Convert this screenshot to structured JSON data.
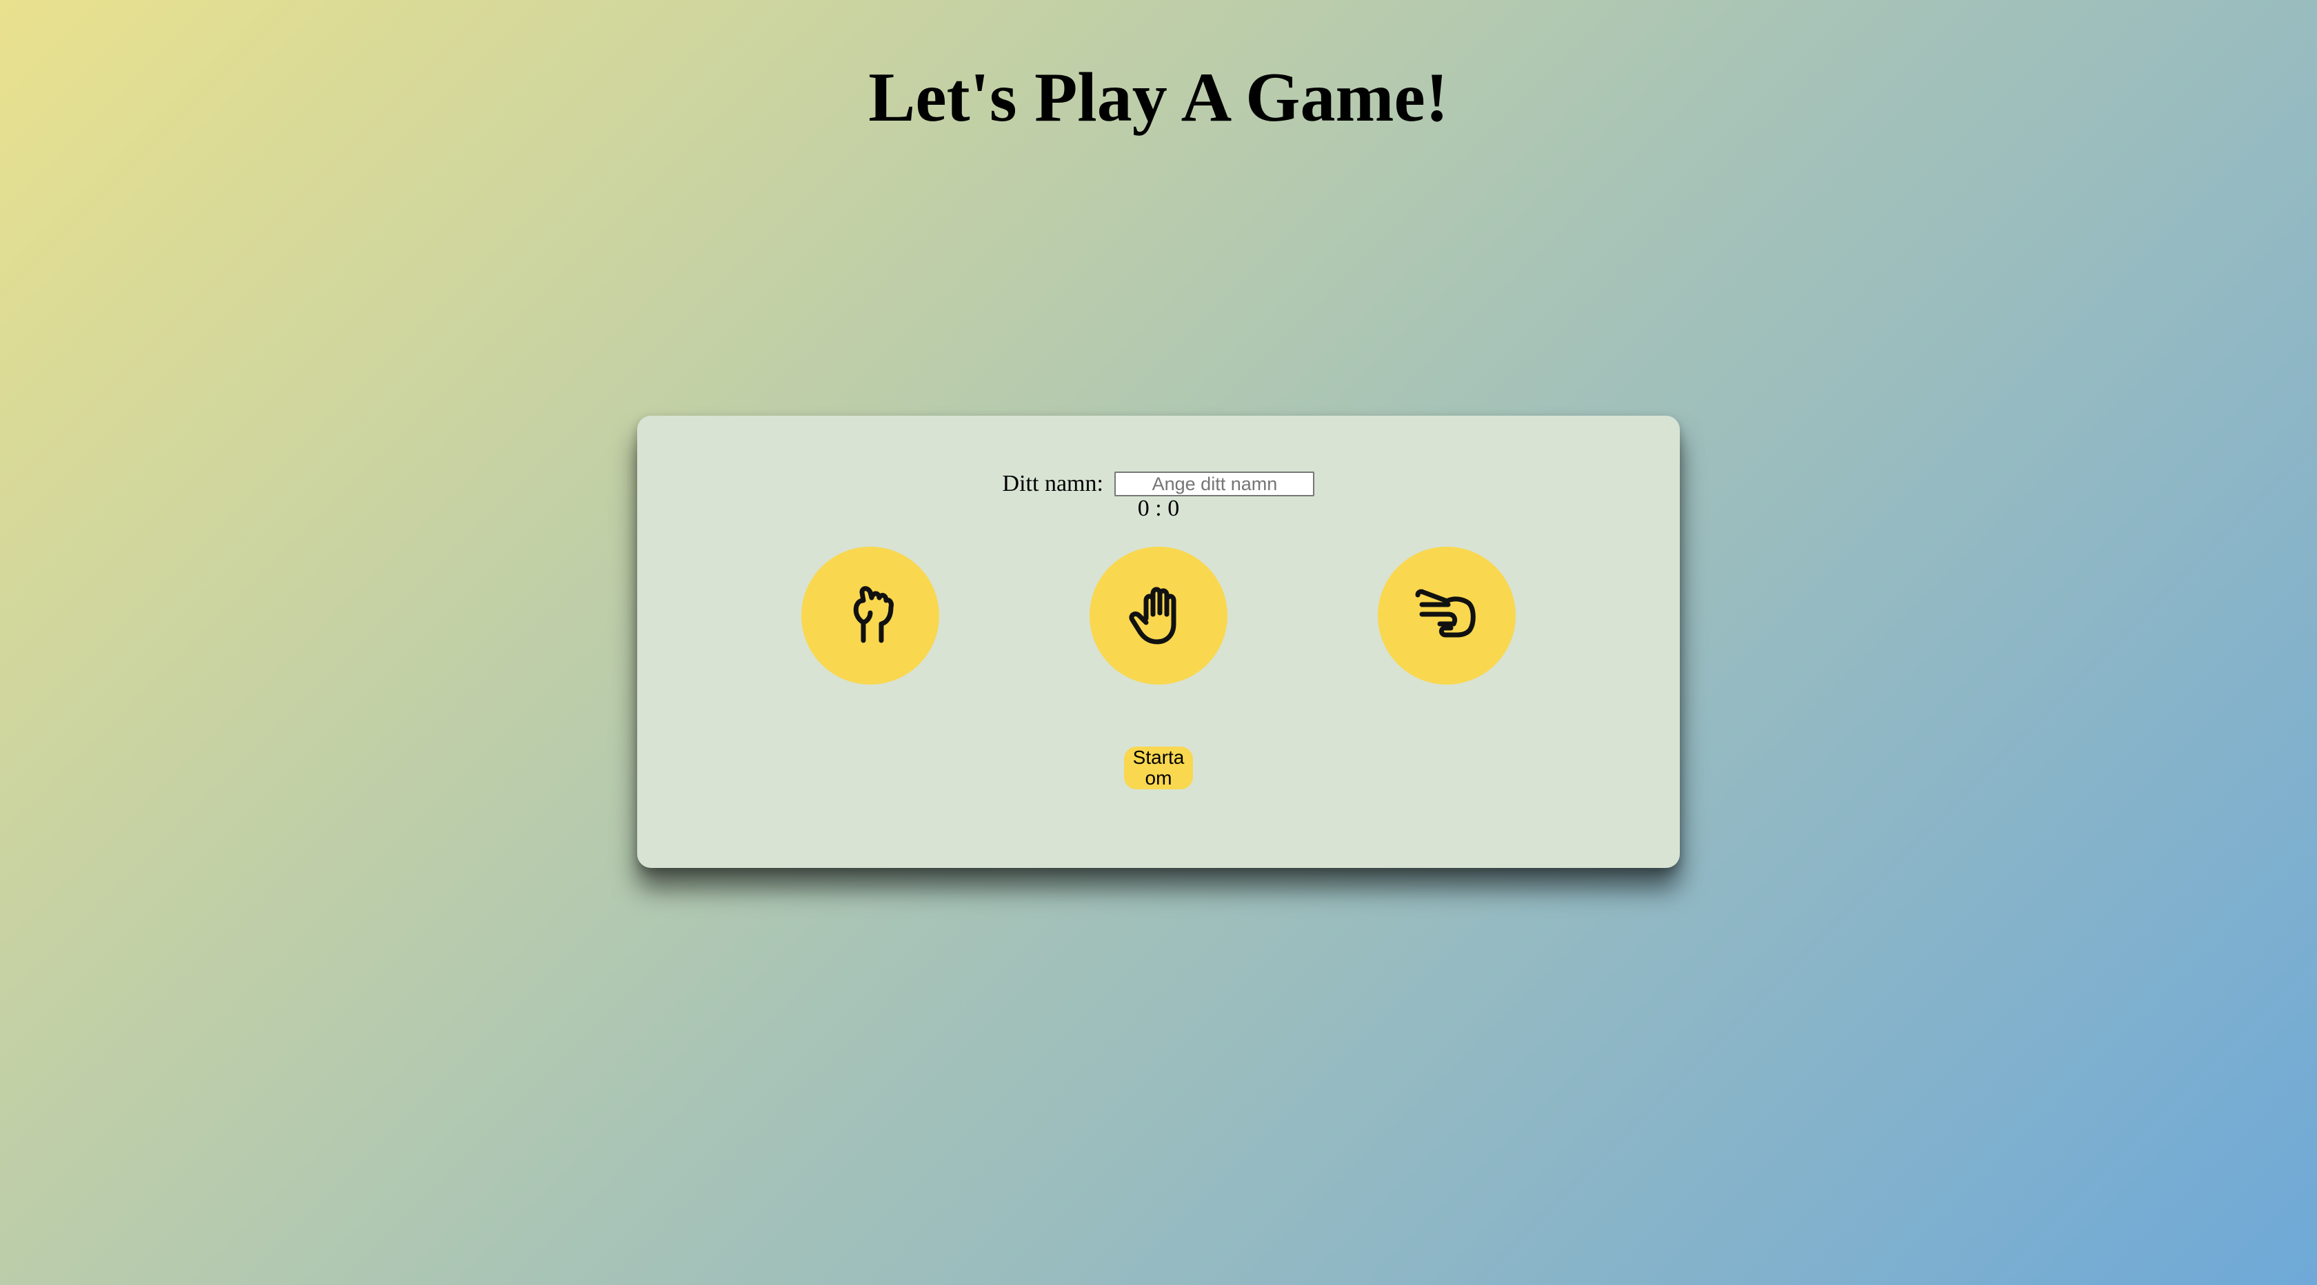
{
  "page": {
    "title": "Let's Play A Game!"
  },
  "game": {
    "name_label": "Ditt namn:",
    "name_input": {
      "value": "",
      "placeholder": "Ange ditt namn"
    },
    "score_text": "0 : 0",
    "choices": [
      {
        "id": "rock",
        "icon": "fist-icon"
      },
      {
        "id": "paper",
        "icon": "open-hand-icon"
      },
      {
        "id": "scissors",
        "icon": "scissors-hand-icon"
      }
    ],
    "restart_label": "Starta om"
  },
  "colors": {
    "accent": "#f9d74f",
    "card_background": "#d8e3d4",
    "gradient_start": "#e9e18e",
    "gradient_end": "#6fa9d8"
  }
}
